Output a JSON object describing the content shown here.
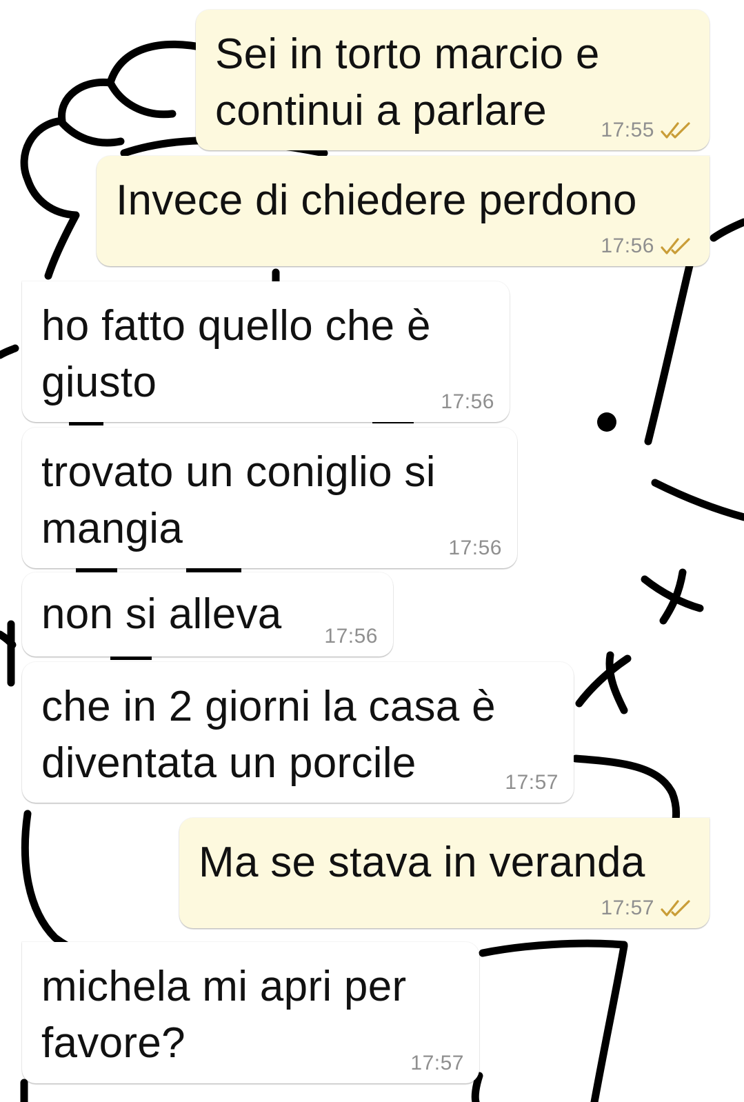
{
  "theme": {
    "outgoing_bubble": "#fdf9de",
    "incoming_bubble": "#ffffff",
    "timestamp_color": "#8f8f8f",
    "read_ticks_color": "#c99d37",
    "wallpaper": "black-line-cartoon-drawing"
  },
  "messages": [
    {
      "direction": "outgoing",
      "lines": [
        "Sei in torto marcio e",
        "continui a parlare"
      ],
      "time": "17:55",
      "status": "read-double-check-icon"
    },
    {
      "direction": "outgoing",
      "lines": [
        "Invece di chiedere perdono"
      ],
      "time": "17:56",
      "status": "read-double-check-icon"
    },
    {
      "direction": "incoming",
      "lines": [
        "ho fatto quello che è",
        "giusto"
      ],
      "time": "17:56"
    },
    {
      "direction": "incoming",
      "lines": [
        "trovato un coniglio si",
        "mangia"
      ],
      "time": "17:56"
    },
    {
      "direction": "incoming",
      "lines": [
        "non si alleva"
      ],
      "time": "17:56"
    },
    {
      "direction": "incoming",
      "lines": [
        "che in 2 giorni la casa è",
        "diventata un porcile"
      ],
      "time": "17:57"
    },
    {
      "direction": "outgoing",
      "lines": [
        "Ma se stava in veranda"
      ],
      "time": "17:57",
      "status": "read-double-check-icon"
    },
    {
      "direction": "incoming",
      "lines": [
        "michela mi apri per",
        "favore?"
      ],
      "time": "17:57"
    }
  ]
}
